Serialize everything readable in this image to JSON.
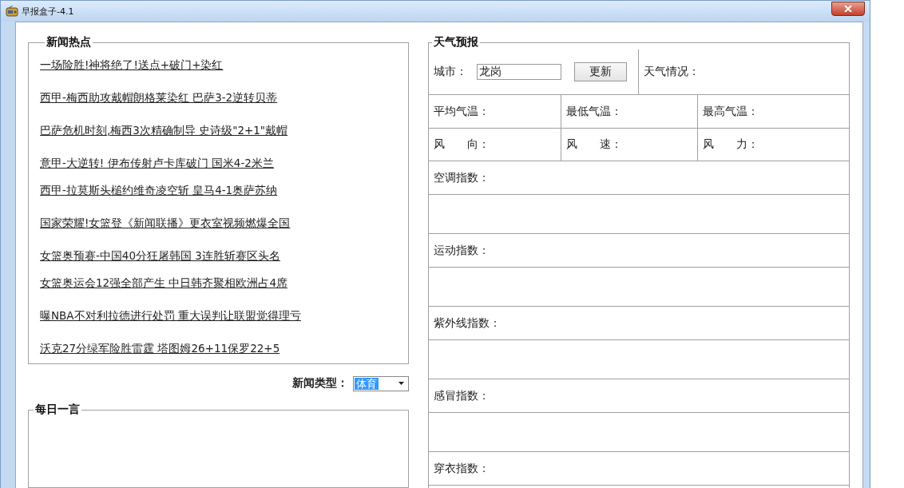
{
  "window": {
    "title": "早报盒子-4.1"
  },
  "news": {
    "title": "新闻热点",
    "items": [
      {
        "text": "一场险胜!神将绝了!送点+破门+染红"
      },
      {
        "text": "西甲-梅西助攻戴帽朗格莱染红 巴萨3-2逆转贝蒂"
      },
      {
        "text": "巴萨危机时刻,梅西3次精确制导 史诗级\"2+1\"戴帽"
      },
      {
        "text": "意甲-大逆转! 伊布传射卢卡库破门 国米4-2米兰"
      },
      {
        "text": "西甲-拉莫斯头槌约维奇凌空斩 皇马4-1奥萨苏纳"
      },
      {
        "text": "国家荣耀!女篮登《新闻联播》更衣室视频燃爆全国"
      },
      {
        "text": "女篮奥预赛-中国40分狂屠韩国 3连胜斩赛区头名"
      },
      {
        "text": "女篮奥运会12强全部产生 中日韩齐聚相欧洲占4席"
      },
      {
        "text": "曝NBA不对利拉德进行处罚 重大误判让联盟觉得理亏"
      },
      {
        "text": "沃克27分绿军险胜雷霆 塔图姆26+11保罗22+5"
      }
    ]
  },
  "news_type": {
    "label": "新闻类型：",
    "value": "体育"
  },
  "daily_quote": {
    "title": "每日一言"
  },
  "weather": {
    "title": "天气预报",
    "city_label": "城市：",
    "city_value": "龙岗",
    "update_button": "更新",
    "condition_label": "天气情况：",
    "temps": [
      "平均气温：",
      "最低气温：",
      "最高气温："
    ],
    "winds": [
      "风　　向：",
      "风　　速：",
      "风　　力："
    ],
    "indices": [
      "空调指数：",
      "运动指数：",
      "紫外线指数：",
      "感冒指数：",
      "穿衣指数："
    ]
  }
}
